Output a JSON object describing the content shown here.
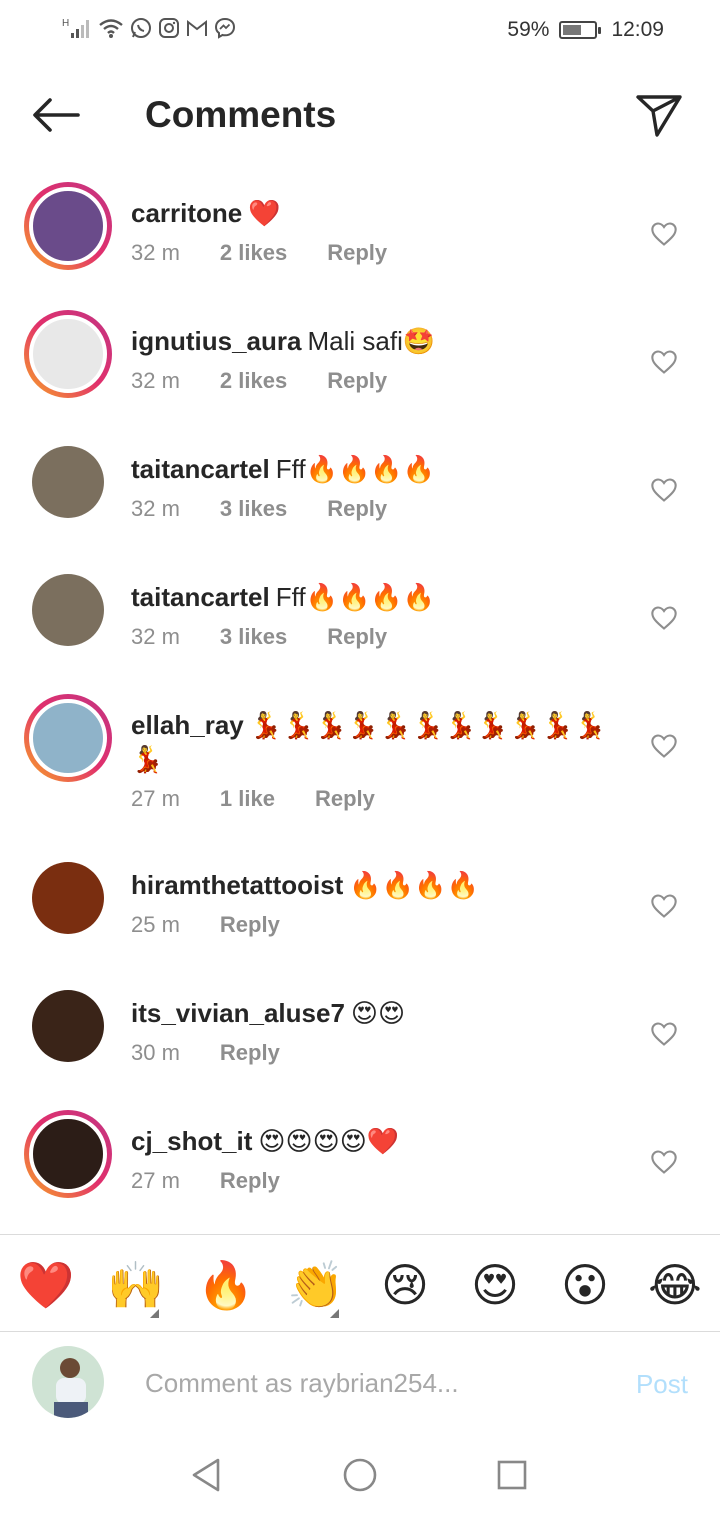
{
  "status_bar": {
    "battery_percent": "59%",
    "battery_level": 0.59,
    "time": "12:09",
    "icons": [
      "signal-h-icon",
      "wifi-icon",
      "whatsapp-icon",
      "instagram-icon",
      "gmail-icon",
      "messenger-icon"
    ]
  },
  "header": {
    "title": "Comments",
    "back_icon": "arrow-left-icon",
    "send_icon": "paper-plane-icon"
  },
  "comments": [
    {
      "user": "carritone",
      "text": "❤️",
      "time": "32 m",
      "likes": "2 likes",
      "reply": "Reply",
      "story": true,
      "avatar_color": "#6a4b8a"
    },
    {
      "user": "ignutius_aura",
      "text": "Mali safi🤩",
      "time": "32 m",
      "likes": "2 likes",
      "reply": "Reply",
      "story": true,
      "avatar_color": "#e8e8e8"
    },
    {
      "user": "taitancartel",
      "text": "Fff🔥🔥🔥🔥",
      "time": "32 m",
      "likes": "3 likes",
      "reply": "Reply",
      "story": false,
      "avatar_color": "#7b6f5e"
    },
    {
      "user": "taitancartel",
      "text": "Fff🔥🔥🔥🔥",
      "time": "32 m",
      "likes": "3 likes",
      "reply": "Reply",
      "story": false,
      "avatar_color": "#7b6f5e"
    },
    {
      "user": "ellah_ray",
      "text": "💃💃💃💃💃💃💃💃💃💃💃💃",
      "time": "27 m",
      "likes": "1 like",
      "reply": "Reply",
      "story": true,
      "avatar_color": "#8fb3c9"
    },
    {
      "user": "hiramthetattooist",
      "text": "🔥🔥🔥🔥",
      "time": "25 m",
      "likes": "",
      "reply": "Reply",
      "story": false,
      "avatar_color": "#7a2e10"
    },
    {
      "user": "its_vivian_aluse7",
      "text": "😍😍",
      "time": "30 m",
      "likes": "",
      "reply": "Reply",
      "story": false,
      "avatar_color": "#3a2418"
    },
    {
      "user": "cj_shot_it",
      "text": "😍😍😍😍❤️",
      "time": "27 m",
      "likes": "",
      "reply": "Reply",
      "story": true,
      "avatar_color": "#2c1d17"
    }
  ],
  "emoji_bar": [
    "❤️",
    "🙌",
    "🔥",
    "👏",
    "😢",
    "😍",
    "😮",
    "😂"
  ],
  "composer": {
    "placeholder": "Comment as raybrian254...",
    "post_label": "Post"
  },
  "colors": {
    "story_ring_start": "#f9a825",
    "story_ring_end": "#c13584",
    "post_disabled": "#b2dffc",
    "meta_gray": "#8e8e8e"
  }
}
